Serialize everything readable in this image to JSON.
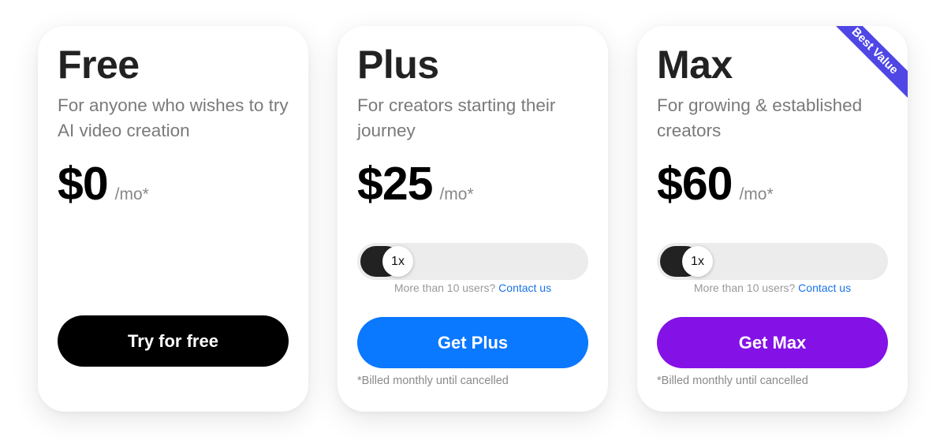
{
  "plans": [
    {
      "name": "Free",
      "description": "For anyone who wishes to try AI video creation",
      "price": "$0",
      "period": "/mo*",
      "cta_label": "Try for free"
    },
    {
      "name": "Plus",
      "description": "For creators starting their journey",
      "price": "$25",
      "period": "/mo*",
      "slider_value": "1x",
      "contact_prefix": "More than 10 users?",
      "contact_link": "Contact us",
      "cta_label": "Get Plus",
      "note": "*Billed monthly until cancelled",
      "accent": "#0a78ff"
    },
    {
      "name": "Max",
      "description": "For growing & established creators",
      "price": "$60",
      "period": "/mo*",
      "badge": "Best Value",
      "slider_value": "1x",
      "contact_prefix": "More than 10 users?",
      "contact_link": "Contact us",
      "cta_label": "Get Max",
      "note": "*Billed monthly until cancelled",
      "accent": "#8412e6"
    }
  ]
}
